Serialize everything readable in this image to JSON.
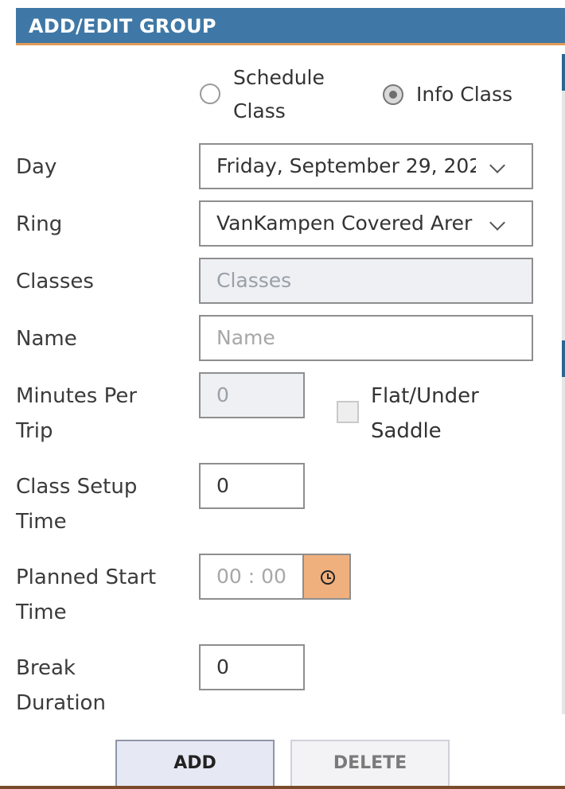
{
  "header": {
    "title": "ADD/EDIT GROUP"
  },
  "type_radio": {
    "schedule_label_line1": "Schedule",
    "schedule_label_line2": "Class",
    "info_label": "Info Class",
    "selected": "Info Class"
  },
  "fields": {
    "day": {
      "label": "Day",
      "value": "Friday, September 29, 202"
    },
    "ring": {
      "label": "Ring",
      "value": "VanKampen Covered Arer"
    },
    "classes": {
      "label": "Classes",
      "placeholder": "Classes"
    },
    "name": {
      "label": "Name",
      "placeholder": "Name"
    },
    "minutes_per_trip": {
      "label_line1": "Minutes Per",
      "label_line2": "Trip",
      "value": "0"
    },
    "flat_under_saddle": {
      "label_line1": "Flat/Under",
      "label_line2": "Saddle",
      "checked": false
    },
    "class_setup_time": {
      "label_line1": "Class Setup",
      "label_line2": "Time",
      "value": "0"
    },
    "planned_start_time": {
      "label_line1": "Planned Start",
      "label_line2": "Time",
      "placeholder": "00 : 00"
    },
    "break_duration": {
      "label_line1": "Break",
      "label_line2": "Duration",
      "value": "0"
    }
  },
  "buttons": {
    "add": "ADD",
    "delete": "DELETE"
  },
  "icons": {
    "clock": "clock-icon",
    "chevron": "chevron-down-icon"
  },
  "colors": {
    "header_bg": "#3f78a6",
    "header_accent": "#e39a57",
    "clock_button_bg": "#efb07e"
  }
}
